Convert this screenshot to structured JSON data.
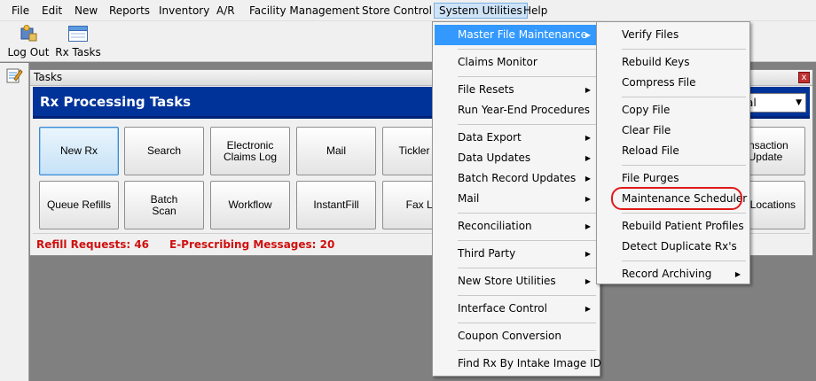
{
  "menubar": {
    "items": [
      "File",
      "Edit",
      "New",
      "Reports",
      "Inventory",
      "A/R",
      "Facility Management",
      "Store Control",
      "System Utilities",
      "Help"
    ]
  },
  "toolbar": {
    "logout_label": "Log Out",
    "rxtasks_label": "Rx Tasks"
  },
  "tasks_window": {
    "title": "Tasks",
    "close_glyph": "x",
    "header_title": "Rx Processing Tasks",
    "header_select_value": "al",
    "row1": [
      "New Rx",
      "Search",
      "Electronic\nClaims Log",
      "Mail",
      "Tickler Se",
      "ansaction\nUpdate"
    ],
    "row2": [
      "Queue Refills",
      "Batch\nScan",
      "Workflow",
      "InstantFill",
      "Fax Lo",
      "gn Locations"
    ],
    "refill_requests": "Refill Requests: 46",
    "eprescribing": "E-Prescribing Messages: 20"
  },
  "system_utilities_menu": {
    "items": [
      {
        "label": "Master File Maintenance",
        "submenu": true
      },
      {
        "label": "Claims Monitor",
        "submenu": false
      },
      {
        "label": "File Resets",
        "submenu": true
      },
      {
        "label": "Run Year-End Procedures",
        "submenu": false
      },
      {
        "label": "Data Export",
        "submenu": true
      },
      {
        "label": "Data Updates",
        "submenu": true
      },
      {
        "label": "Batch Record Updates",
        "submenu": true
      },
      {
        "label": "Mail",
        "submenu": true
      },
      {
        "label": "Reconciliation",
        "submenu": true
      },
      {
        "label": "Third Party",
        "submenu": true
      },
      {
        "label": "New Store Utilities",
        "submenu": true
      },
      {
        "label": "Interface Control",
        "submenu": true
      },
      {
        "label": "Coupon Conversion",
        "submenu": false
      },
      {
        "label": "Find Rx By Intake Image ID",
        "submenu": false
      }
    ]
  },
  "master_file_submenu": {
    "items": [
      {
        "label": "Verify Files",
        "submenu": false
      },
      {
        "label": "Rebuild Keys",
        "submenu": false
      },
      {
        "label": "Compress File",
        "submenu": false
      },
      {
        "label": "Copy File",
        "submenu": false
      },
      {
        "label": "Clear File",
        "submenu": false
      },
      {
        "label": "Reload File",
        "submenu": false
      },
      {
        "label": "File Purges",
        "submenu": false
      },
      {
        "label": "Maintenance Scheduler",
        "submenu": false
      },
      {
        "label": "Rebuild Patient Profiles",
        "submenu": false
      },
      {
        "label": "Detect Duplicate Rx's",
        "submenu": false
      },
      {
        "label": "Record Archiving",
        "submenu": true
      }
    ]
  },
  "colors": {
    "header_blue": "#003399",
    "menu_highlight": "#3399ff",
    "status_red": "#d01010",
    "annotation_red": "#e01818"
  },
  "icons": {
    "arrow": "▶",
    "dropdown": "▼"
  }
}
